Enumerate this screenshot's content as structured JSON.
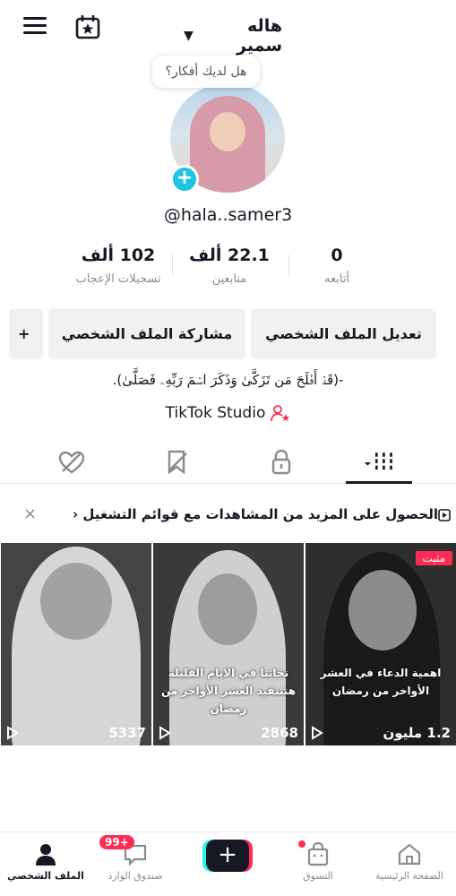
{
  "header": {
    "title": "هاله سمير",
    "menu_icon": "hamburger-menu-icon",
    "calendar_icon": "calendar-star-icon"
  },
  "profile": {
    "note_bubble": "هل لديك أفكار؟",
    "username": "@hala..samer3",
    "stats": {
      "following_count": "0",
      "following_label": "أتابعه",
      "followers_count": "22.1 ألف",
      "followers_label": "متابعين",
      "likes_count": "102 ألف",
      "likes_label": "تسجيلات الإعجاب"
    },
    "buttons": {
      "edit": "تعديل الملف الشخصي",
      "share": "مشاركة الملف الشخصي",
      "add_friend": "+"
    },
    "bio": "-(قَدۡ أَفۡلَحَ مَن تَزَكَّىٰ وَذَكَرَ اسۡمَ رَبِّهِۦ فَصَلَّىٰ).",
    "studio_link": "TikTok Studio"
  },
  "promo": {
    "text": "الحصول على المزيد من المشاهدات مع قوائم التشغيل ‹",
    "close": "×"
  },
  "videos": [
    {
      "views": "1.2 مليون",
      "pinned_label": "مثبت",
      "caption": "اهمية الدعاء في العشر الأواخر من رمضان"
    },
    {
      "views": "2868",
      "caption": "نجاتنا في الايام القليلة هتتنفيد العشر الأواخر من رمضان"
    },
    {
      "views": "5337"
    }
  ],
  "bottom_nav": {
    "home": "الصفحة الرئيسية",
    "shop": "التسوق",
    "create": "+",
    "inbox": "صندوق الوارد",
    "inbox_badge": "99+",
    "profile": "الملف الشخصي"
  },
  "colors": {
    "accent": "#fe2c55",
    "cyan": "#25f4ee",
    "text": "#161823",
    "muted": "#8a8b91"
  }
}
